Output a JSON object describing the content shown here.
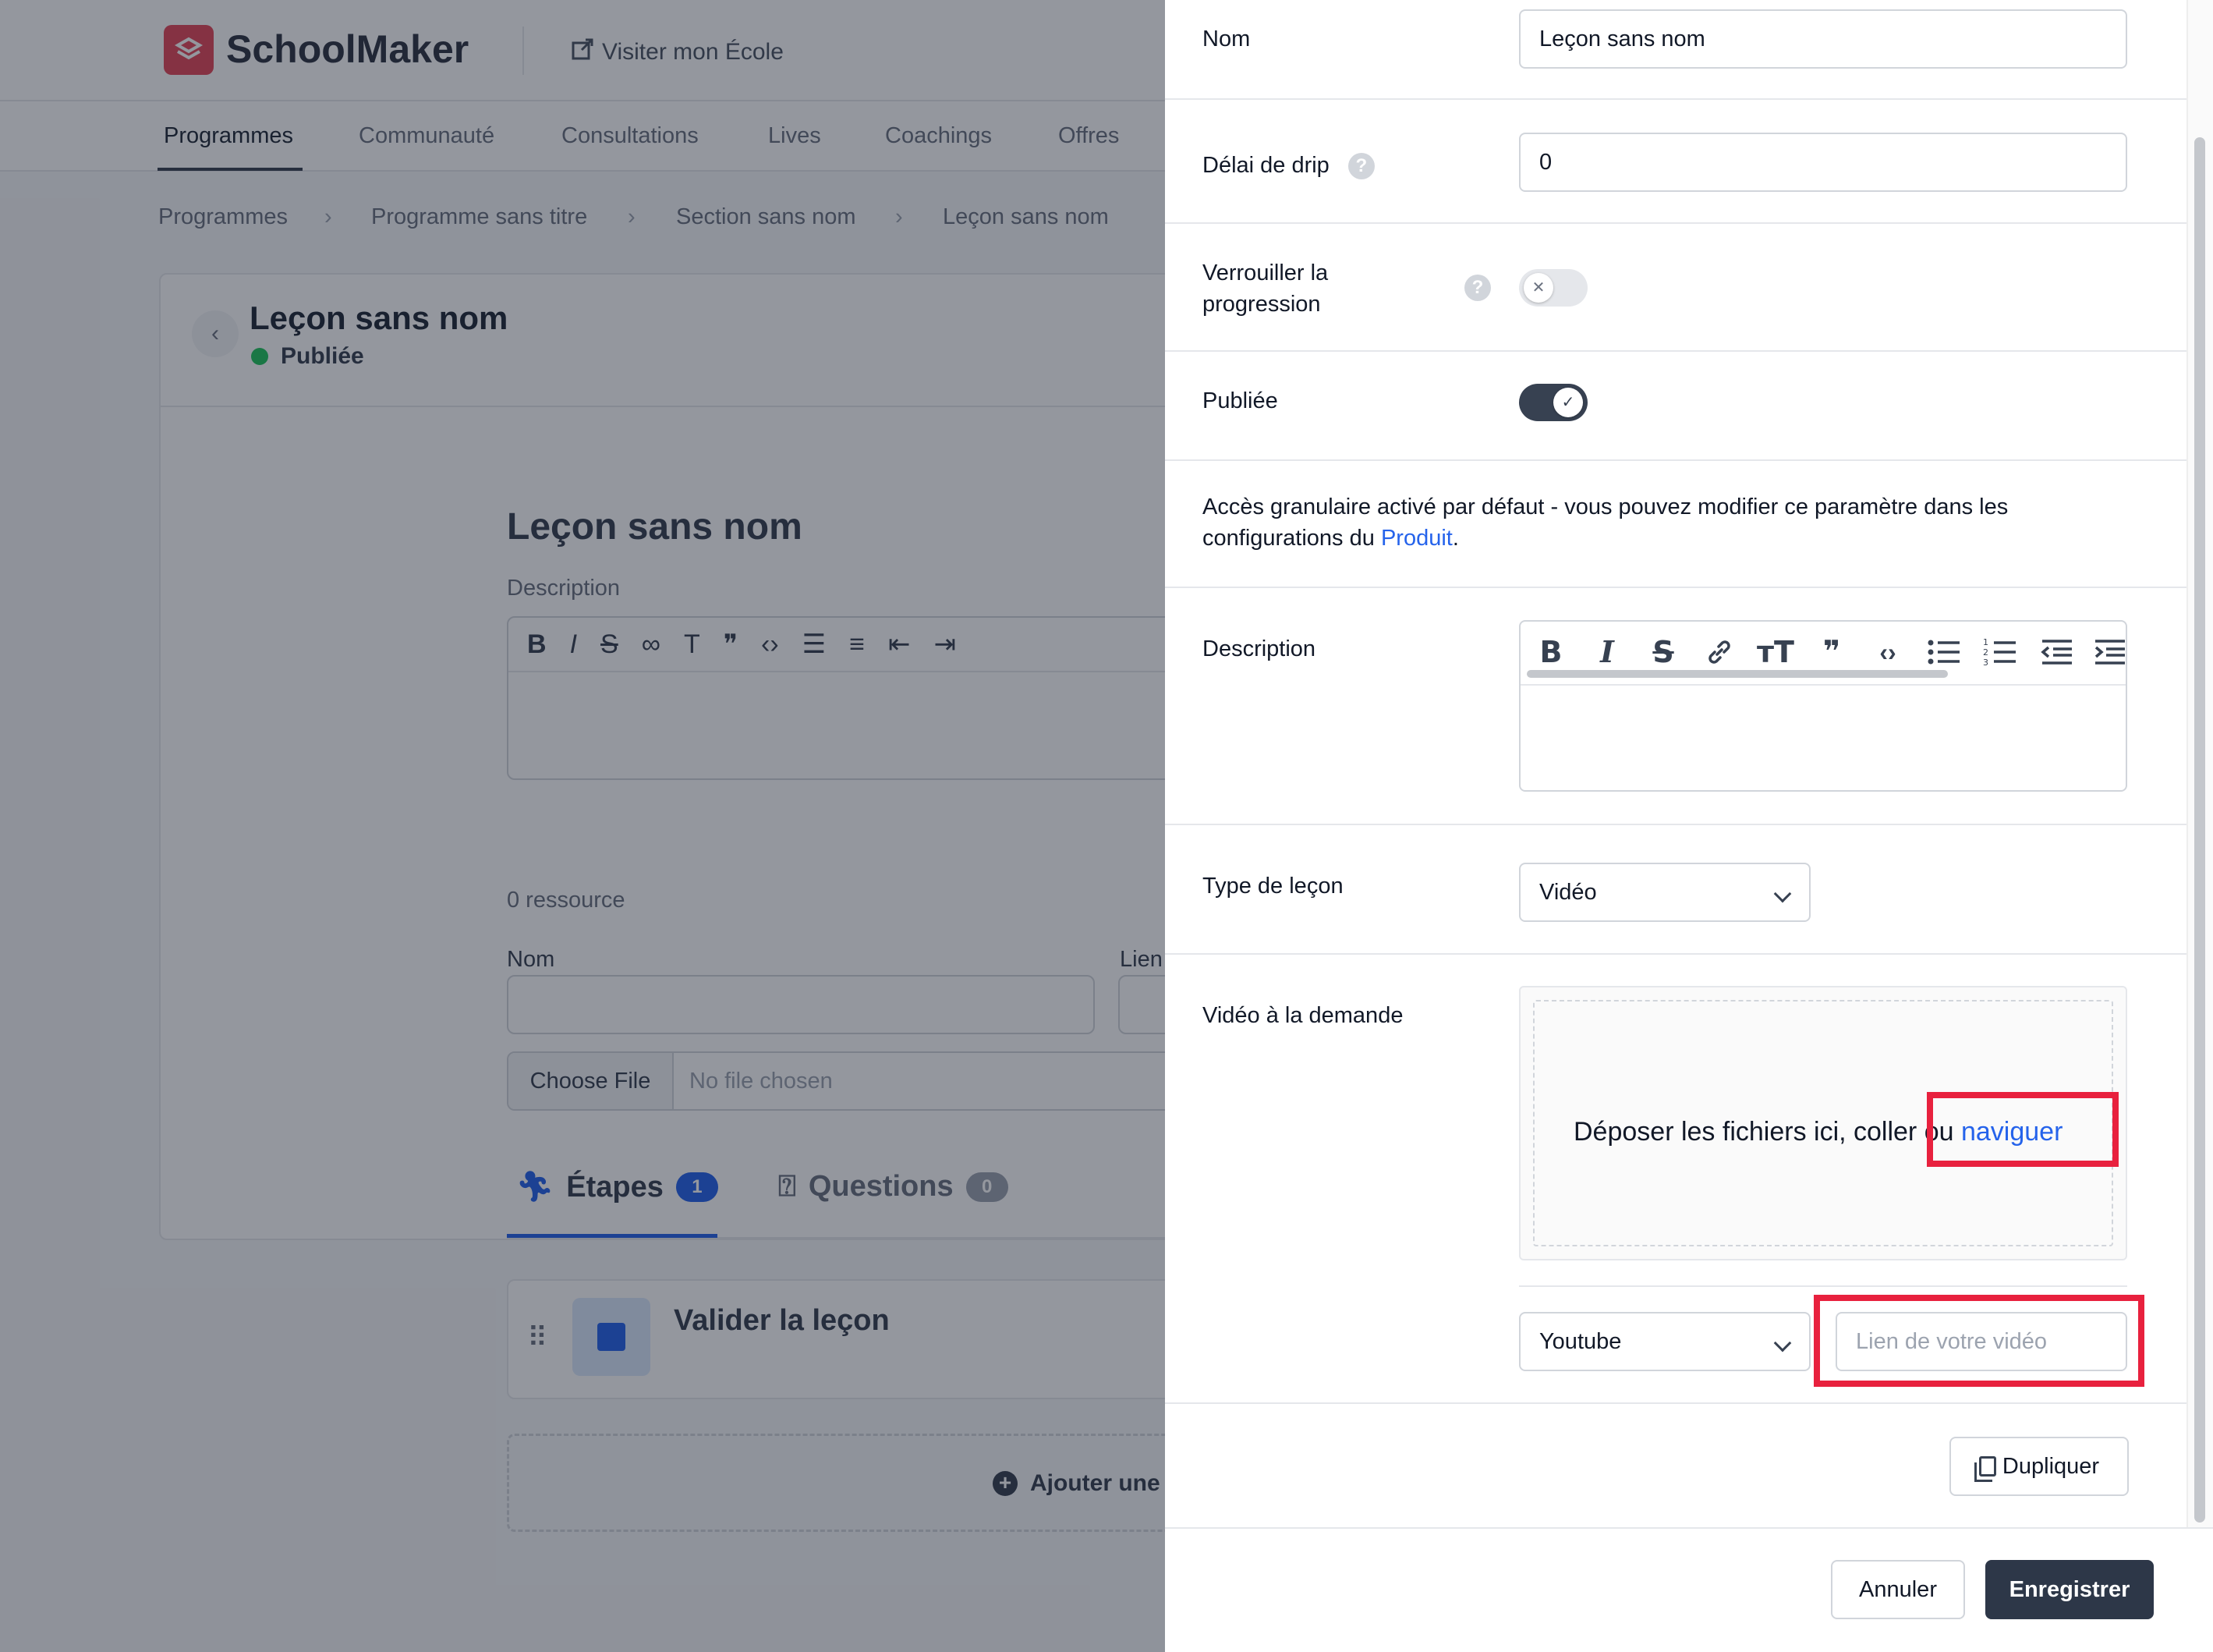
{
  "background": {
    "brand": "SchoolMaker",
    "visit_link": "Visiter mon École",
    "nav_tabs": [
      "Programmes",
      "Communauté",
      "Consultations",
      "Lives",
      "Coachings",
      "Offres"
    ],
    "breadcrumb": [
      "Programmes",
      "Programme sans titre",
      "Section sans nom",
      "Leçon sans nom"
    ],
    "lesson_title": "Leçon sans nom",
    "lesson_status": "Publiée",
    "content_title": "Leçon sans nom",
    "description_label": "Description",
    "resources_count": "0 ressource",
    "name_label": "Nom",
    "link_label": "Lien",
    "file_button": "Choose File",
    "file_status": "No file chosen",
    "tab_steps": "Étapes",
    "tab_steps_count": "1",
    "tab_questions": "Questions",
    "tab_questions_count": "0",
    "step_title": "Valider la leçon",
    "add_step": "Ajouter une"
  },
  "drawer": {
    "name_label": "Nom",
    "name_value": "Leçon sans nom",
    "drip_label": "Délai de drip",
    "drip_value": "0",
    "lock_label_line1": "Verrouiller la",
    "lock_label_line2": "progression",
    "lock_enabled": false,
    "published_label": "Publiée",
    "published_enabled": true,
    "info_text": "Accès granulaire activé par défaut - vous pouvez modifier ce paramètre dans les configurations du ",
    "info_link": "Produit",
    "info_end": ".",
    "description_label": "Description",
    "lesson_type_label": "Type de leçon",
    "lesson_type_value": "Vidéo",
    "vod_label": "Vidéo à la demande",
    "drop_text": "Déposer les fichiers ici, coller ou ",
    "drop_link": "naviguer",
    "video_source_value": "Youtube",
    "video_link_placeholder": "Lien de votre vidéo",
    "duplicate_button": "Dupliquer",
    "cancel_button": "Annuler",
    "save_button": "Enregistrer"
  },
  "colors": {
    "accent": "#2563eb",
    "primary_dark": "#2d3748",
    "highlight": "#e8213e",
    "brand": "#e4485a"
  }
}
